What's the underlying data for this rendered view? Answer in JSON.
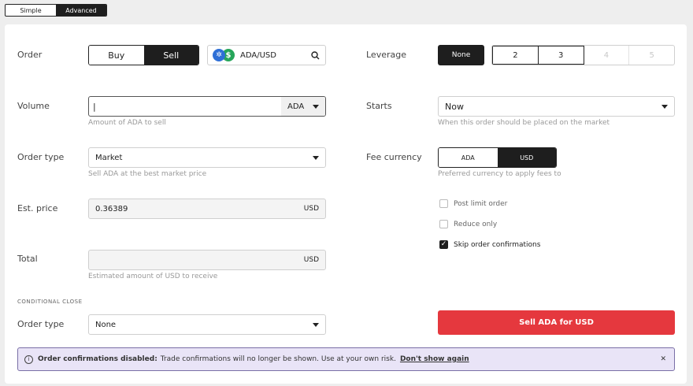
{
  "mode": {
    "simple": "Simple",
    "advanced": "Advanced"
  },
  "order": {
    "label": "Order",
    "buy": "Buy",
    "sell": "Sell",
    "pair": "ADA/USD"
  },
  "volume": {
    "label": "Volume",
    "value": "|",
    "unit": "ADA",
    "hint": "Amount of ADA to sell"
  },
  "order_type": {
    "label": "Order type",
    "value": "Market",
    "hint": "Sell ADA at the best market price"
  },
  "est_price": {
    "label": "Est. price",
    "value": "0.36389",
    "unit": "USD"
  },
  "total": {
    "label": "Total",
    "value": "",
    "unit": "USD",
    "hint": "Estimated amount of USD to receive"
  },
  "conditional_close": {
    "section": "CONDITIONAL CLOSE",
    "label": "Order type",
    "value": "None"
  },
  "leverage": {
    "label": "Leverage",
    "none": "None",
    "options": [
      "2",
      "3",
      "4",
      "5"
    ]
  },
  "starts": {
    "label": "Starts",
    "value": "Now",
    "hint": "When this order should be placed on the market"
  },
  "fee_currency": {
    "label": "Fee currency",
    "ada": "ADA",
    "usd": "USD",
    "hint": "Preferred currency to apply fees to"
  },
  "checkboxes": {
    "post_limit": "Post limit order",
    "reduce_only": "Reduce only",
    "skip_confirm": "Skip order confirmations",
    "checkmark": "✓"
  },
  "submit": {
    "label": "Sell ADA for USD",
    "color": "#e5383e"
  },
  "banner": {
    "title": "Order confirmations disabled:",
    "text": "Trade confirmations will no longer be shown. Use at your own risk.",
    "link": "Don't show again",
    "close": "✕",
    "info": "i",
    "bg": "#e9e4f7",
    "border": "#7a6fa6"
  },
  "icons": {
    "ada_glyph": "✲",
    "usd_glyph": "$"
  }
}
